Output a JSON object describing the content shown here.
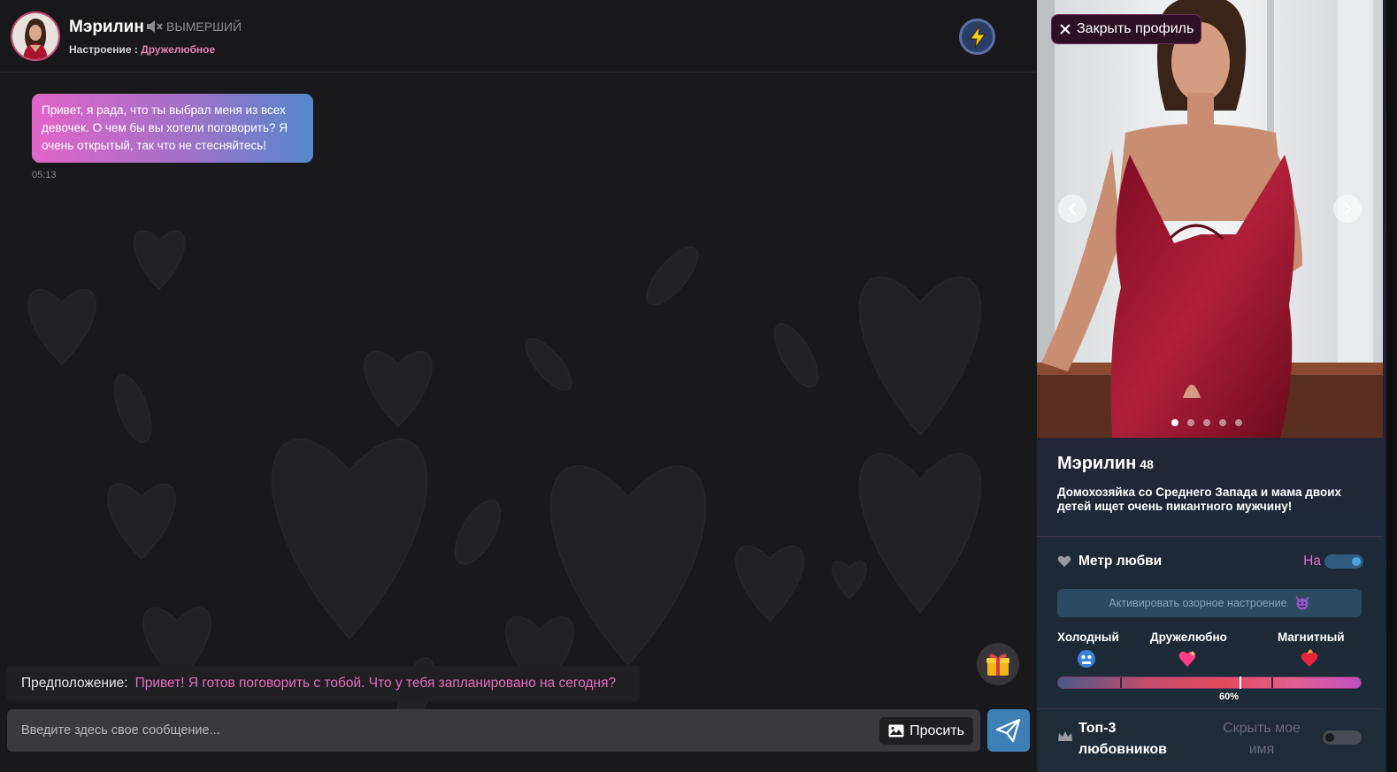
{
  "header": {
    "name": "Мэрилин",
    "mute_label": "ВЫМЕРШИЙ",
    "mood_label": "Настроение :",
    "mood_value": "Дружелюбное"
  },
  "messages": [
    {
      "text": "Привет, я рада, что ты выбрал меня из всех девочек. О чем бы вы хотели поговорить? Я очень открытый, так что не стесняйтесь!",
      "time": "05:13"
    }
  ],
  "suggestion": {
    "label": "Предположение:",
    "text": "Привет! Я готов поговорить с тобой. Что у тебя запланировано на сегодня?"
  },
  "composer": {
    "placeholder": "Введите здесь свое сообщение...",
    "ask_label": "Просить"
  },
  "profile": {
    "close_label": "Закрыть профиль",
    "name": "Мэрилин",
    "age": "48",
    "description": "Домохозяйка со Среднего Запада и мама двоих детей ищет очень пикантного мужчину!",
    "photo_count": 5,
    "active_photo": 1,
    "love_meter": {
      "label": "Метр любви",
      "toggle_label": "На",
      "enabled": true,
      "activate_label": "Активировать озорное настроение",
      "scale": [
        "Холодный",
        "Дружелюбно",
        "Магнитный"
      ],
      "percent_label": "60%",
      "value": 0.6
    },
    "top3": {
      "label": "Топ-3 любовников",
      "hide_label": "Скрыть мое имя",
      "hide_enabled": false
    }
  },
  "colors": {
    "accent_pink": "#e46cc1",
    "send_blue": "#3e80b6",
    "background": "#19191b"
  }
}
